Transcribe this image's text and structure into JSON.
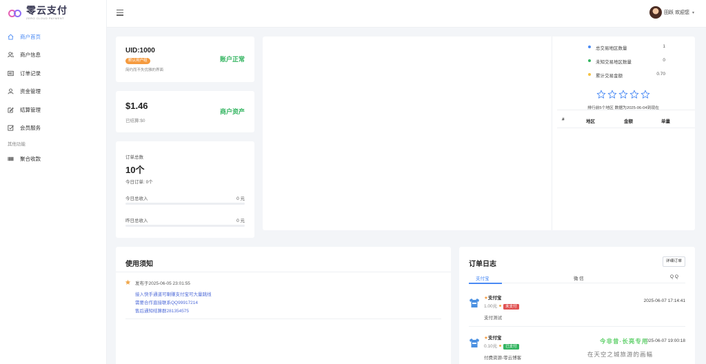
{
  "brand": {
    "name": "零云支付",
    "subtitle": "ZERO CLOUD PAYMENT"
  },
  "sidebar": {
    "items": [
      {
        "label": "商户首页",
        "icon": "home-icon",
        "active": true
      },
      {
        "label": "商户信息",
        "icon": "users-icon"
      },
      {
        "label": "订单记录",
        "icon": "order-icon"
      },
      {
        "label": "资金管理",
        "icon": "funds-icon"
      },
      {
        "label": "结算管理",
        "icon": "edit-icon"
      },
      {
        "label": "会员服务",
        "icon": "checkbox-icon"
      }
    ],
    "section_label": "其他功能",
    "extra_items": [
      {
        "label": "聚合收款",
        "icon": "barcode-icon"
      }
    ]
  },
  "header": {
    "user_name": "田跃 欢迎您",
    "menu_icon": "hamburger-icon"
  },
  "account": {
    "uid": "UID:1000",
    "badge": "默认用户组",
    "desc": "简约而不失优雅的界面",
    "status": "账户正常",
    "balance": "$1.46",
    "settled": "已结算:$0",
    "balance_label": "商户资产"
  },
  "orders": {
    "title": "订单总数",
    "count": "10个",
    "today_orders": "今日订单:  0个",
    "today_income_label": "今日总收入",
    "today_income": "0 元",
    "yesterday_income_label": "昨日总收入",
    "yesterday_income": "0 元"
  },
  "region_stats": {
    "legend": [
      {
        "label": "总交易地区数量",
        "value": "1",
        "color": "#4a8af4"
      },
      {
        "label": "未知交易地区数量",
        "value": "0",
        "color": "#34b561"
      },
      {
        "label": "累计交易金额",
        "value": "0.70",
        "color": "#f5c242"
      }
    ],
    "rank_caption": "排行前5个地区  数据为2025-06-04到现在",
    "columns": [
      "#",
      "地区",
      "金额",
      "单量"
    ],
    "star_count": 5
  },
  "notice": {
    "title": "使用须知",
    "date": "发布于2025-06-05 23:01:55",
    "lines": [
      "接入快手通道可喇赚支付宝可大量跳线",
      "需要合作直接联系QQ99917214",
      "售后通知结算群281354575"
    ]
  },
  "order_log": {
    "title": "订单日志",
    "detail_button": "详细订单",
    "tabs": [
      "支付宝",
      "微 信",
      "Q Q"
    ],
    "items": [
      {
        "channel": "支付宝",
        "amount": "1.00元",
        "status": "未支付",
        "status_color": "#e05252",
        "remark": "支付测试",
        "time": "2025-06-07 17:14:41"
      },
      {
        "channel": "支付宝",
        "amount": "0.10元",
        "status": "已支付",
        "status_color": "#34b561",
        "remark": "付费资源-零云博客",
        "time": "2025-06-07 19:00:18"
      }
    ]
  },
  "watermark": {
    "line1": "今非昔·长亮专用",
    "line2": "在天空之城旅游的画幅"
  }
}
